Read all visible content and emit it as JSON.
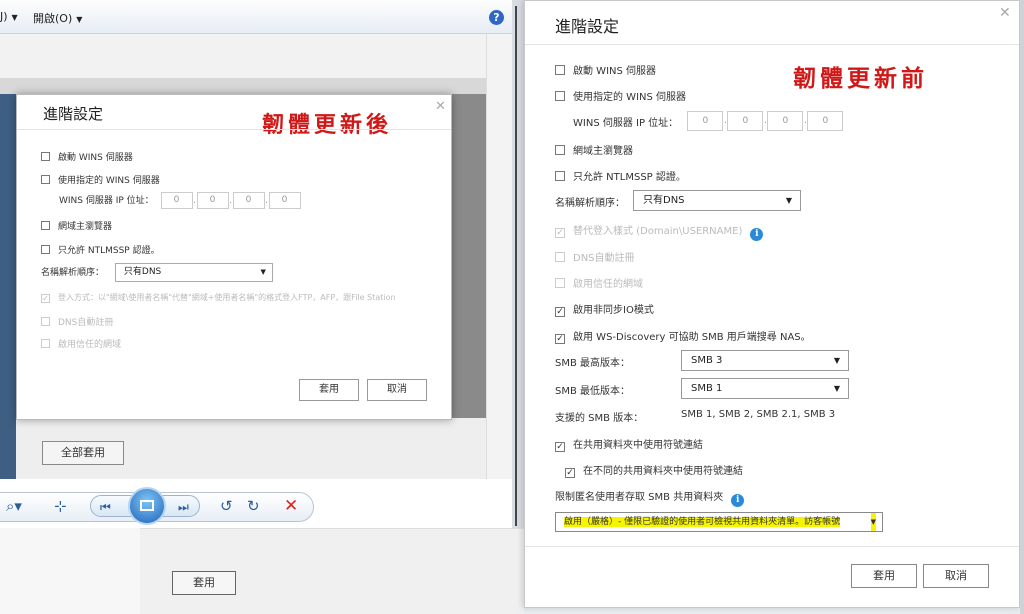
{
  "viewer": {
    "menu": [
      {
        "label": "J)",
        "caret": "▼"
      },
      {
        "label": "開啟(O)",
        "caret": "▼"
      }
    ],
    "help_glyph": "?",
    "bg_apply_all": "全部套用",
    "bg_apply": "套用",
    "toolbar_icons": [
      "zoom-icon",
      "fit-icon",
      "prev-icon",
      "slideshow-icon",
      "next-icon",
      "rotate-ccw-icon",
      "rotate-cw-icon",
      "delete-icon"
    ]
  },
  "after_dialog": {
    "title": "進階設定",
    "annotation": "韌體更新後",
    "enable_wins": "啟動 WINS 伺服器",
    "use_wins": "使用指定的 WINS 伺服器",
    "wins_ip_label": "WINS 伺服器 IP 位址：",
    "ip": [
      "0",
      "0",
      "0",
      "0"
    ],
    "domain_master": "網域主瀏覽器",
    "ntlmssp": "只允許 NTLMSSP 認證。",
    "name_order_label": "名稱解析順序：",
    "name_order_value": "只有DNS",
    "login_style": "登入方式：以\"網域\\使用者名稱\"代替\"網域+使用者名稱\"的格式登入FTP，AFP，跟File Station",
    "dns_register": "DNS自動註冊",
    "trusted_domain": "啟用信任的網域",
    "apply": "套用",
    "cancel": "取消"
  },
  "before_dialog": {
    "title": "進階設定",
    "annotation": "韌體更新前",
    "enable_wins": "啟動 WINS 伺服器",
    "use_wins": "使用指定的 WINS 伺服器",
    "wins_ip_label": "WINS 伺服器 IP 位址：",
    "ip": [
      "0",
      "0",
      "0",
      "0"
    ],
    "domain_master": "網域主瀏覽器",
    "ntlmssp": "只允許 NTLMSSP 認證。",
    "name_order_label": "名稱解析順序：",
    "name_order_value": "只有DNS",
    "alt_login": "替代登入樣式 (Domain\\USERNAME)",
    "dns_register": "DNS自動註冊",
    "trusted_domain": "啟用信任的網域",
    "async_io": "啟用非同步IO模式",
    "ws_discovery": "啟用 WS-Discovery 可協助 SMB 用戶端搜尋 NAS。",
    "smb_max_label": "SMB 最高版本：",
    "smb_max_value": "SMB 3",
    "smb_min_label": "SMB 最低版本：",
    "smb_min_value": "SMB 1",
    "smb_supported_label": "支援的 SMB 版本：",
    "smb_supported_value": "SMB 1, SMB 2, SMB 2.1, SMB 3",
    "symlink_shared": "在共用資料夾中使用符號連結",
    "symlink_cross": "在不同的共用資料夾中使用符號連結",
    "anon_label": "限制匿名使用者存取 SMB 共用資料夾",
    "anon_value": "啟用（嚴格）- 僅限已驗證的使用者可檢視共用資料夾清單。訪客帳號",
    "apply": "套用",
    "cancel": "取消"
  }
}
